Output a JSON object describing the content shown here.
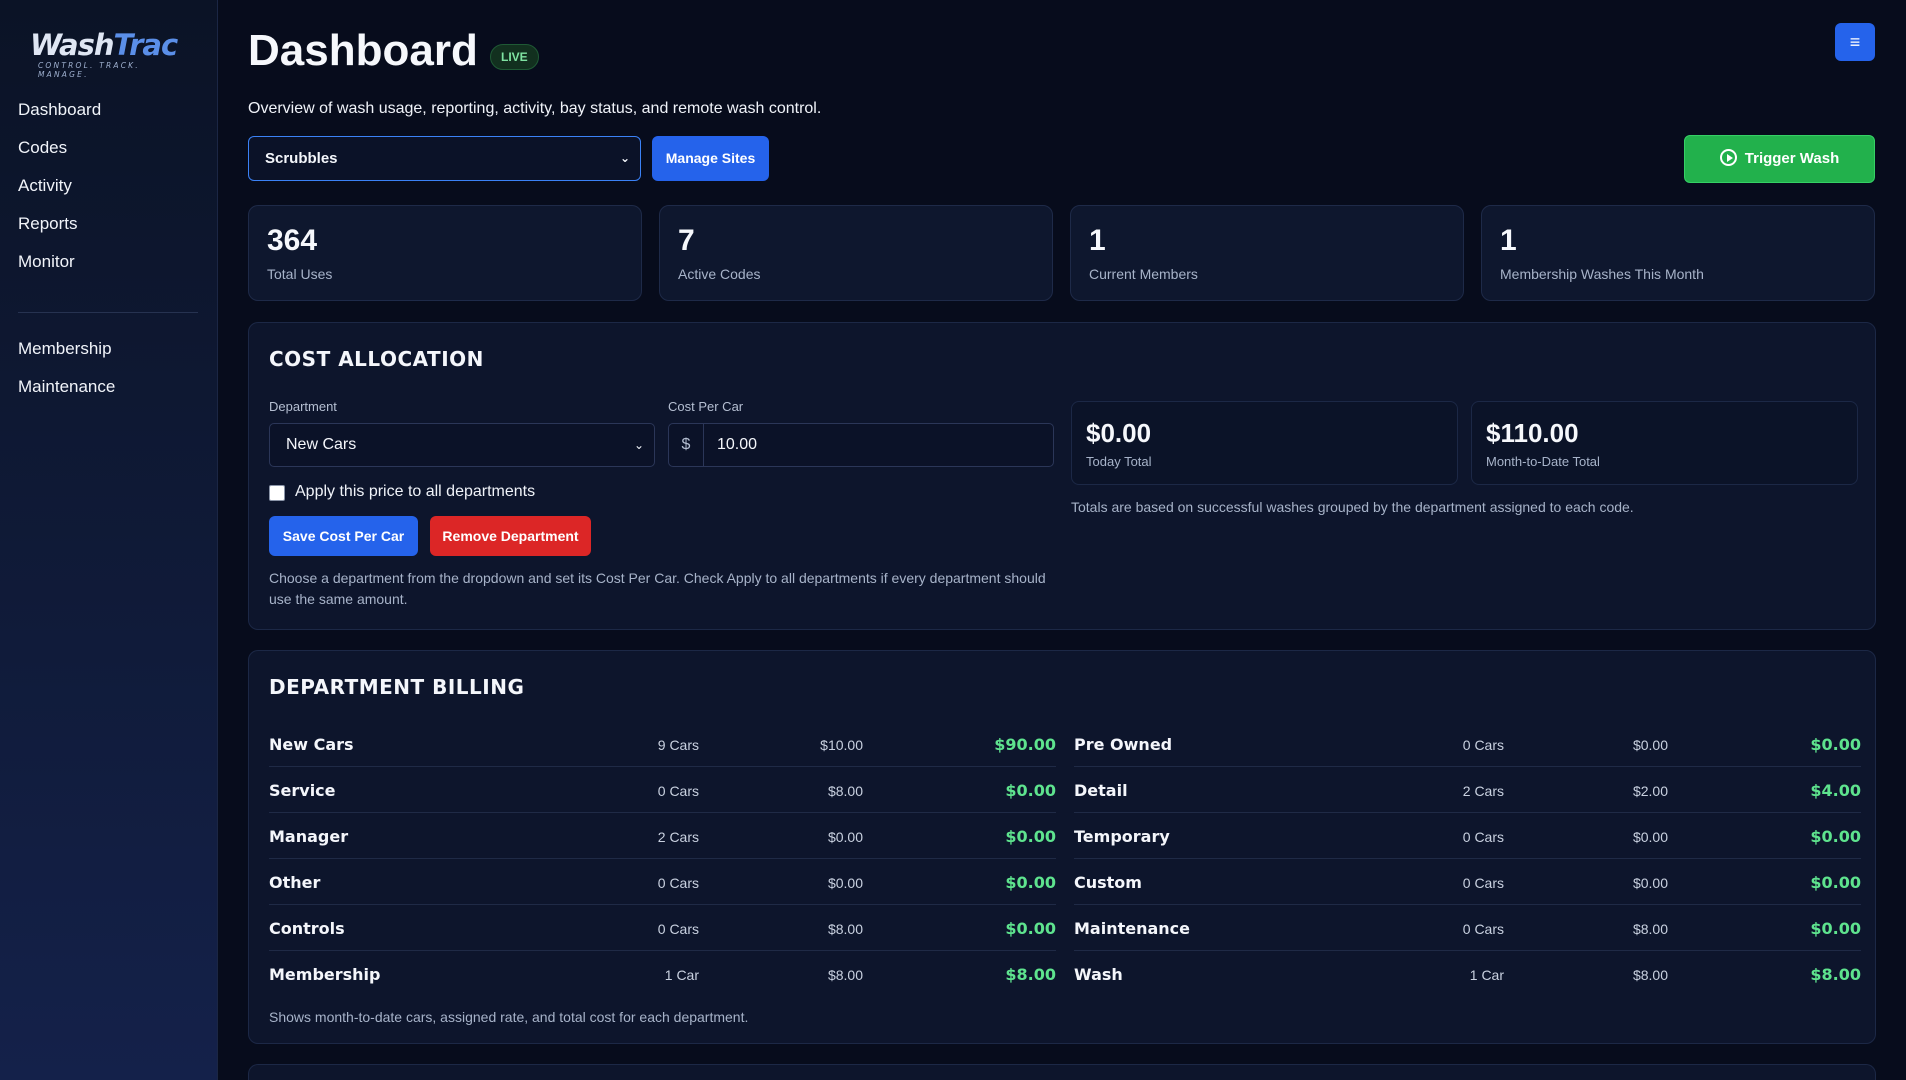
{
  "app": {
    "logo_primary": "Wash",
    "logo_secondary": "Trac",
    "logo_tagline": "CONTROL. TRACK. MANAGE."
  },
  "sidebar": {
    "items": [
      {
        "label": "Dashboard"
      },
      {
        "label": "Codes"
      },
      {
        "label": "Activity"
      },
      {
        "label": "Reports"
      },
      {
        "label": "Monitor"
      }
    ],
    "secondary_items": [
      {
        "label": "Membership"
      },
      {
        "label": "Maintenance"
      }
    ]
  },
  "header": {
    "title": "Dashboard",
    "badge": "LIVE",
    "menu_icon": "≡",
    "subtitle": "Overview of wash usage, reporting, activity, bay status, and remote wash control."
  },
  "controls": {
    "site_selected": "Scrubbles",
    "manage_sites_label": "Manage Sites",
    "trigger_wash_label": "Trigger Wash"
  },
  "stats": [
    {
      "value": "364",
      "label": "Total Uses"
    },
    {
      "value": "7",
      "label": "Active Codes"
    },
    {
      "value": "1",
      "label": "Current Members"
    },
    {
      "value": "1",
      "label": "Membership Washes This Month"
    }
  ],
  "cost_allocation": {
    "title": "COST ALLOCATION",
    "department_label": "Department",
    "department_selected": "New Cars",
    "cost_label": "Cost Per Car",
    "cost_prefix": "$",
    "cost_value": "10.00",
    "apply_all_label": "Apply this price to all departments",
    "save_label": "Save Cost Per Car",
    "remove_label": "Remove Department",
    "help": "Choose a department from the dropdown and set its Cost Per Car. Check Apply to all departments if every department should use the same amount.",
    "today_total": "$0.00",
    "today_label": "Today Total",
    "mtd_total": "$110.00",
    "mtd_label": "Month-to-Date Total",
    "totals_note": "Totals are based on successful washes grouped by the department assigned to each code."
  },
  "billing": {
    "title": "DEPARTMENT BILLING",
    "left": [
      {
        "name": "New Cars",
        "cars": "9 Cars",
        "rate": "$10.00",
        "total": "$90.00"
      },
      {
        "name": "Service",
        "cars": "0 Cars",
        "rate": "$8.00",
        "total": "$0.00"
      },
      {
        "name": "Manager",
        "cars": "2 Cars",
        "rate": "$0.00",
        "total": "$0.00"
      },
      {
        "name": "Other",
        "cars": "0 Cars",
        "rate": "$0.00",
        "total": "$0.00"
      },
      {
        "name": "Controls",
        "cars": "0 Cars",
        "rate": "$8.00",
        "total": "$0.00"
      },
      {
        "name": "Membership",
        "cars": "1 Car",
        "rate": "$8.00",
        "total": "$8.00"
      }
    ],
    "right": [
      {
        "name": "Pre Owned",
        "cars": "0 Cars",
        "rate": "$0.00",
        "total": "$0.00"
      },
      {
        "name": "Detail",
        "cars": "2 Cars",
        "rate": "$2.00",
        "total": "$4.00"
      },
      {
        "name": "Temporary",
        "cars": "0 Cars",
        "rate": "$0.00",
        "total": "$0.00"
      },
      {
        "name": "Custom",
        "cars": "0 Cars",
        "rate": "$0.00",
        "total": "$0.00"
      },
      {
        "name": "Maintenance",
        "cars": "0 Cars",
        "rate": "$8.00",
        "total": "$0.00"
      },
      {
        "name": "Wash",
        "cars": "1 Car",
        "rate": "$8.00",
        "total": "$8.00"
      }
    ],
    "note": "Shows month-to-date cars, assigned rate, and total cost for each department."
  },
  "colors": {
    "accent": "#2563eb",
    "success": "#22b14c",
    "danger": "#dc2626",
    "money": "#5ee38e"
  }
}
